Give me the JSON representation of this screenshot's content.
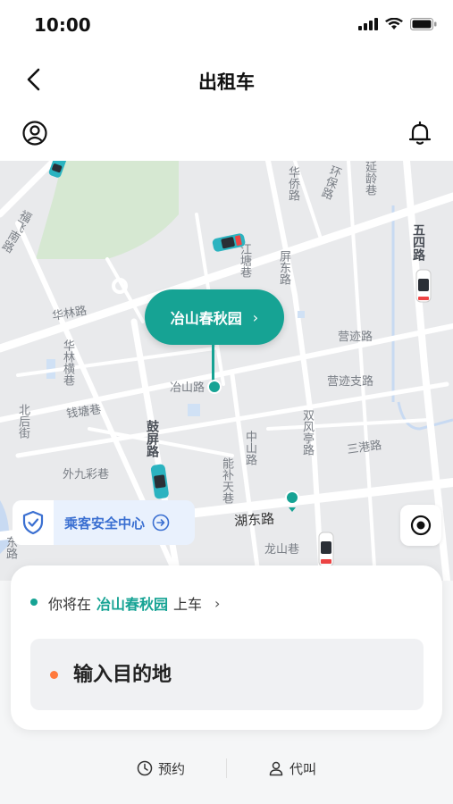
{
  "status": {
    "time": "10:00"
  },
  "header": {
    "title": "出租车"
  },
  "map": {
    "bubble_label": "冶山春秋园",
    "roads": [
      {
        "name": "福飞南路"
      },
      {
        "name": "华侨路"
      },
      {
        "name": "环保路"
      },
      {
        "name": "延龄巷"
      },
      {
        "name": "五四路"
      },
      {
        "name": "江塘巷"
      },
      {
        "name": "屏东路"
      },
      {
        "name": "华林路"
      },
      {
        "name": "华林横巷"
      },
      {
        "name": "营迹路"
      },
      {
        "name": "冶山路"
      },
      {
        "name": "营迹支路"
      },
      {
        "name": "钱塘巷"
      },
      {
        "name": "北后街"
      },
      {
        "name": "双风亭路"
      },
      {
        "name": "三港路"
      },
      {
        "name": "鼓屏路"
      },
      {
        "name": "中山路"
      },
      {
        "name": "外九彩巷"
      },
      {
        "name": "能补天巷"
      },
      {
        "name": "湖东路"
      },
      {
        "name": "龙山巷"
      },
      {
        "name": "东路"
      }
    ],
    "safety_center": "乘客安全中心"
  },
  "card": {
    "pickup_prefix": "你将在",
    "pickup_place": "冶山春秋园",
    "pickup_suffix": "上车",
    "destination_placeholder": "输入目的地"
  },
  "bottom": {
    "reserve": "预约",
    "call_for_others": "代叫"
  },
  "colors": {
    "accent": "#16a394",
    "destination_dot": "#ff7a3d",
    "safety_text": "#3a6fd1"
  }
}
